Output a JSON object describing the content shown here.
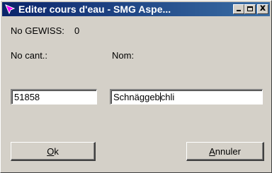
{
  "window": {
    "title": "Editer cours d'eau - SMG Aspe...",
    "controls": {
      "minimize": "minimize",
      "maximize": "maximize",
      "close": "x"
    }
  },
  "form": {
    "gewiss_label": "No GEWISS:",
    "gewiss_value": "0",
    "cant_label": "No cant.:",
    "nom_label": "Nom:",
    "cant_value": "51858",
    "nom_value_before_caret": "Schnäggeb",
    "nom_value_after_caret": "chli"
  },
  "buttons": {
    "ok_mnemonic": "O",
    "ok_rest": "k",
    "annuler_mnemonic": "A",
    "annuler_rest": "nnuler"
  },
  "icons": {
    "app": "arrow-app-icon"
  }
}
